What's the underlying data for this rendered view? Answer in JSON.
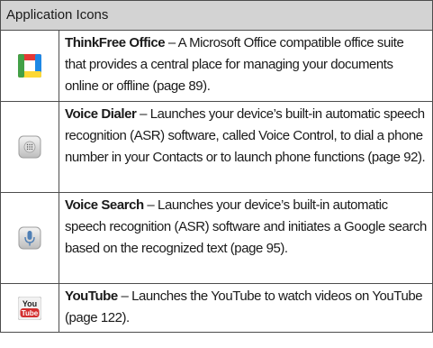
{
  "table": {
    "header": "Application Icons",
    "rows": [
      {
        "icon": "thinkfree-office-icon",
        "name": "ThinkFree Office",
        "description": " – A Microsoft Office compatible office suite that provides a central place for managing your documents online or offline (page 89)."
      },
      {
        "icon": "voice-dialer-icon",
        "name": "Voice Dialer",
        "description": " – Launches your device’s built-in automatic speech recognition (ASR) software, called Voice Control, to dial a phone number in your Contacts or to launch phone functions (page 92)."
      },
      {
        "icon": "voice-search-icon",
        "name": "Voice Search",
        "description": " – Launches your device’s built-in automatic speech recognition (ASR) software and initiates a Google search based on the recognized text (page 95)."
      },
      {
        "icon": "youtube-icon",
        "name": "YouTube",
        "description": " – Launches the YouTube to watch videos on YouTube (page 122).",
        "icon_text_top": "You",
        "icon_text_bottom": "Tube"
      }
    ]
  }
}
